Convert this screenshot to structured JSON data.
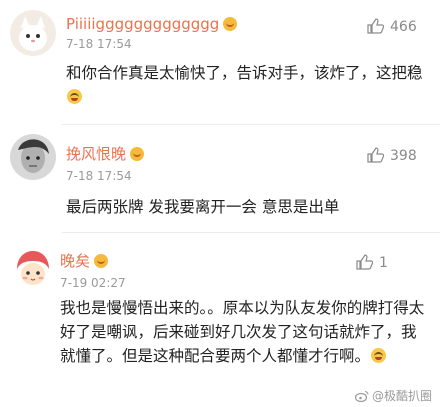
{
  "comments": [
    {
      "username": "Piiiiiggggggggggggg",
      "time": "7-18 17:54",
      "likes": "466",
      "text": "和你合作真是太愉快了，告诉对手，该炸了，这把稳"
    },
    {
      "username": "挽风恨晚",
      "time": "7-18 17:54",
      "likes": "398",
      "text": "最后两张牌 发我要离开一会 意思是出单"
    },
    {
      "username": "晚矣",
      "time": "7-19 02:27",
      "likes": "1",
      "text": "我也是慢慢悟出来的。。原本以为队友发你的牌打得太好了是嘲讽，后来碰到好几次发了这句话就炸了，我就懂了。但是这种配合要两个人都懂才行啊。"
    }
  ],
  "watermark": "@极酷扒圈",
  "colors": {
    "username": "#eb7350",
    "text": "#222222",
    "meta": "#9a9a9a"
  }
}
